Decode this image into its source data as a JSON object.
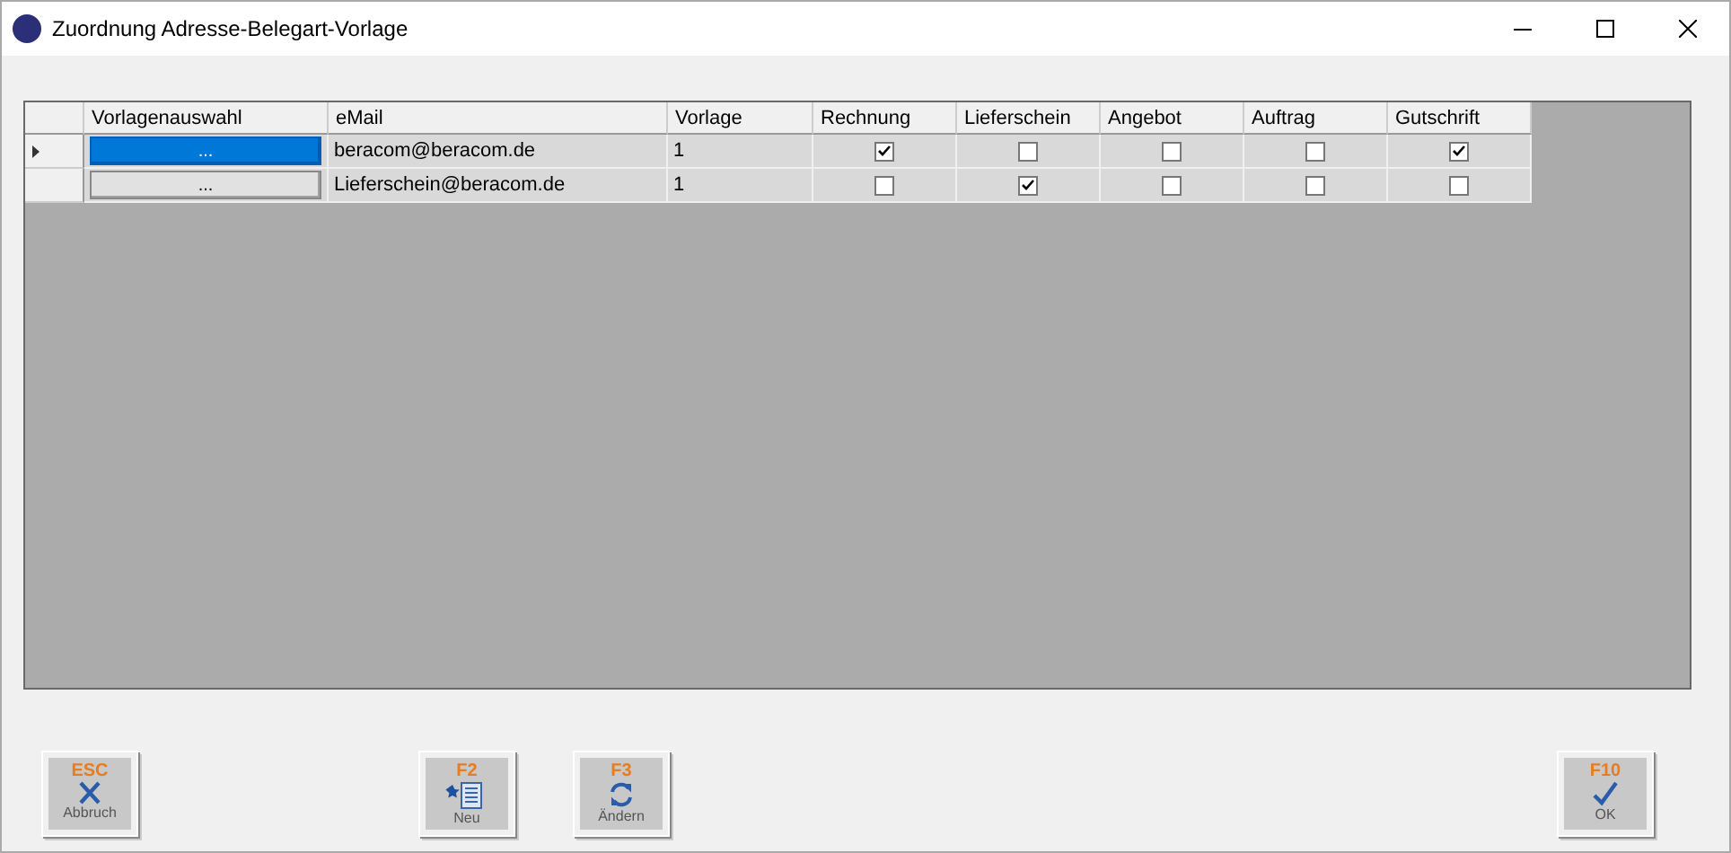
{
  "window": {
    "title": "Zuordnung Adresse-Belegart-Vorlage"
  },
  "grid": {
    "columns": [
      "Vorlagenauswahl",
      "eMail",
      "Vorlage",
      "Rechnung",
      "Lieferschein",
      "Angebot",
      "Auftrag",
      "Gutschrift"
    ],
    "rows": [
      {
        "current": true,
        "chooser": {
          "label": "...",
          "selected": true
        },
        "email": "beracom@beracom.de",
        "vorlage": "1",
        "checks": [
          true,
          false,
          false,
          false,
          true
        ]
      },
      {
        "current": false,
        "chooser": {
          "label": "...",
          "selected": false
        },
        "email": "Lieferschein@beracom.de",
        "vorlage": "1",
        "checks": [
          false,
          true,
          false,
          false,
          false
        ]
      }
    ]
  },
  "buttons": [
    {
      "key": "ESC",
      "label": "Abbruch",
      "kind": "cancel"
    },
    {
      "key": "F2",
      "label": "Neu",
      "kind": "new"
    },
    {
      "key": "F3",
      "label": "Ändern",
      "kind": "change"
    },
    {
      "key": "F10",
      "label": "OK",
      "kind": "ok"
    }
  ]
}
